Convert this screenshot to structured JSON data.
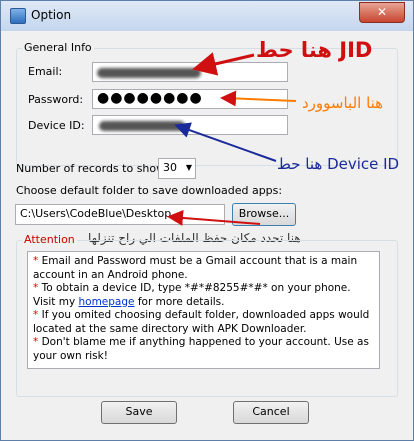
{
  "window": {
    "title": "Option",
    "close_label": "✕"
  },
  "general_info": {
    "legend": "General Info",
    "email_label": "Email:",
    "password_label": "Password:",
    "password_value": "●●●●●●●●",
    "device_label": "Device ID:"
  },
  "annotations": {
    "jid": "هنا حط JID",
    "password": "هنا الباسوورد",
    "device": "هنا حط Device ID",
    "folder": "هنا تحدد مكان حفظ الملفات الي راح تنزلها"
  },
  "records": {
    "label": "Number of records  to show:",
    "value": "30"
  },
  "folder": {
    "label": "Choose default folder to save downloaded apps:",
    "path": "C:\\Users\\CodeBlue\\Desktop",
    "browse_label": "Browse..."
  },
  "attention": {
    "legend": "Attention",
    "line1": "Email and Password must be a Gmail account that is a main account in an Android phone.",
    "line2": "To obtain a device ID, type *#*#8255#*#* on your phone. Visit my ",
    "homepage_link": "homepage",
    "line2_end": " for more details.",
    "line3": "If you omited choosing default folder, downloaded apps would located at the same directory with APK Downloader.",
    "line4": "Don't blame me if anything happened to your account. Use as your own risk!"
  },
  "buttons": {
    "save": "Save",
    "cancel": "Cancel"
  },
  "colors": {
    "annotation_red": "#d01010",
    "annotation_blue": "#1a2a9a",
    "attention_red": "#e00000"
  }
}
